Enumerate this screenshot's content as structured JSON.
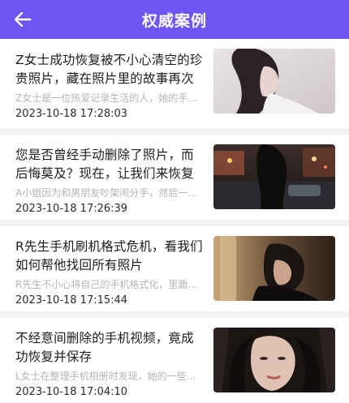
{
  "header": {
    "title": "权威案例",
    "back_icon": "arrow-left-icon",
    "color": "#6d56f2"
  },
  "cases": [
    {
      "title": "Z女士成功恢复被不小心清空的珍贵照片，藏在照片里的故事再次重现",
      "excerpt": "Z女士是一位热爱记录生活的人，她的手…",
      "date": "2023-10-18 17:28:03",
      "thumbnail": "woman-portrait-photo"
    },
    {
      "title": "您是否曾经手动删除了照片，而后悔莫及？现在，让我们来恢复守护吧",
      "excerpt": "A小姐因为和男朋友吵架闹分手，然后一…",
      "date": "2023-10-18 17:26:39",
      "thumbnail": "city-night-street-photo"
    },
    {
      "title": "R先生手机刷机格式危机，看我们如何帮他找回所有照片",
      "excerpt": "R先生不小心将自己的手机格式化，里面…",
      "date": "2023-10-18 17:15:44",
      "thumbnail": "woman-dark-room-photo"
    },
    {
      "title": "不经意间删除的手机视频，竟成功恢复并保存",
      "excerpt": "L女士在整理手机相册时发现，她的一些…",
      "date": "2023-10-18 17:04:10",
      "thumbnail": "woman-closeup-photo"
    }
  ]
}
